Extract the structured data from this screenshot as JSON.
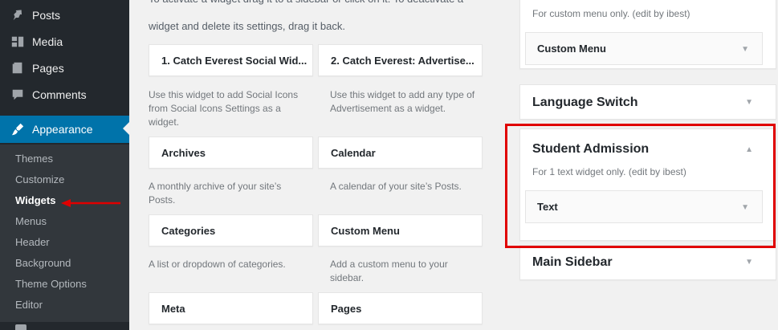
{
  "sidebar": {
    "items": [
      {
        "label": "Posts",
        "icon": "pin-icon"
      },
      {
        "label": "Media",
        "icon": "media-icon"
      },
      {
        "label": "Pages",
        "icon": "pages-icon"
      },
      {
        "label": "Comments",
        "icon": "comments-icon"
      },
      {
        "label": "Appearance",
        "icon": "appearance-icon"
      }
    ],
    "submenu": [
      "Themes",
      "Customize",
      "Widgets",
      "Menus",
      "Header",
      "Background",
      "Theme Options",
      "Editor"
    ],
    "current_submenu": "Widgets"
  },
  "available": {
    "intro_cut": "To activate a widget drag it to a sidebar or click on it. To deactivate a",
    "intro_line2": "widget and delete its settings, drag it back.",
    "widgets": [
      {
        "title": "1. Catch Everest Social Wid...",
        "desc": "Use this widget to add Social Icons from Social Icons Settings as a widget."
      },
      {
        "title": "2. Catch Everest: Advertise...",
        "desc": "Use this widget to add any type of Advertisement as a widget."
      },
      {
        "title": "Archives",
        "desc": "A monthly archive of your site’s Posts."
      },
      {
        "title": "Calendar",
        "desc": "A calendar of your site’s Posts."
      },
      {
        "title": "Categories",
        "desc": "A list or dropdown of categories."
      },
      {
        "title": "Custom Menu",
        "desc": "Add a custom menu to your sidebar."
      },
      {
        "title": "Meta",
        "desc": ""
      },
      {
        "title": "Pages",
        "desc": ""
      }
    ]
  },
  "sidebars": {
    "top_desc": "For custom menu only. (edit by ibest)",
    "top_inner_widget": "Custom Menu",
    "language_switch": "Language Switch",
    "student_admission": {
      "title": "Student Admission",
      "desc": "For 1 text widget only. (edit by ibest)",
      "inner_widget": "Text"
    },
    "main_sidebar": "Main Sidebar"
  },
  "colors": {
    "admin_menu_bg": "#23282d",
    "submenu_bg": "#32373c",
    "active_blue": "#0073aa",
    "highlight_red": "#e00000"
  }
}
